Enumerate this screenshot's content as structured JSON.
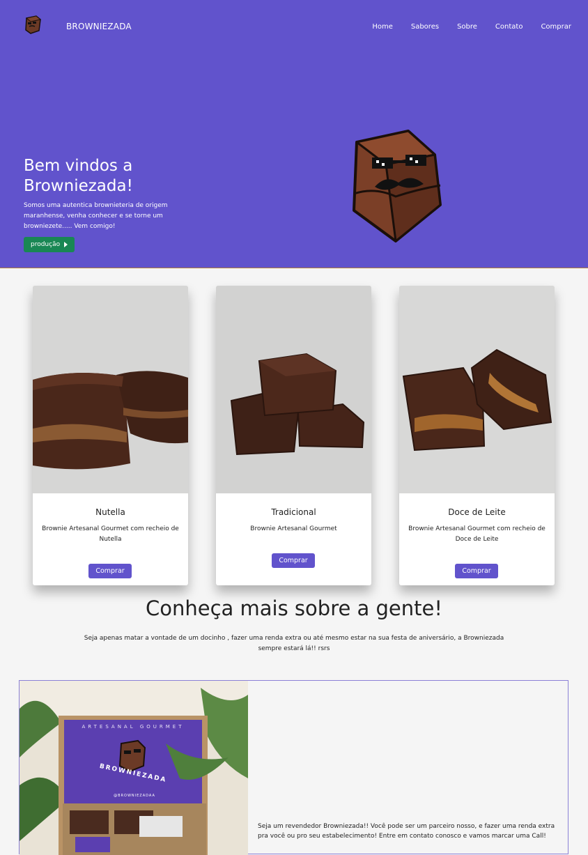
{
  "header": {
    "brand": "BROWNIEZADA",
    "nav": [
      "Home",
      "Sabores",
      "Sobre",
      "Contato",
      "Comprar"
    ]
  },
  "hero": {
    "title": "Bem vindos a Browniezada!",
    "text": "Somos uma autentica brownieteria de origem maranhense, venha conhecer e se torne um browniezete..... Vem comigo!",
    "button": "produção"
  },
  "cards": [
    {
      "title": "Nutella",
      "desc": "Brownie Artesanal Gourmet com recheio de Nutella",
      "button": "Comprar"
    },
    {
      "title": "Tradicional",
      "desc": "Brownie Artesanal Gourmet",
      "button": "Comprar"
    },
    {
      "title": "Doce de Leite",
      "desc": "Brownie Artesanal Gourmet com recheio de Doce de Leite",
      "button": "Comprar"
    }
  ],
  "about": {
    "title": "Conheça mais sobre a gente!",
    "text": "Seja apenas matar a vontade de um docinho , fazer uma renda extra ou até mesmo estar na sua festa de aniversário, a Browniezada sempre estará lá!! rsrs"
  },
  "partner": {
    "box_top": "ARTESANAL GOURMET",
    "box_brand": "BROWNIEZADA",
    "box_handle": "@BROWNIEZADAA",
    "text": "Seja um revendedor Browniezada!! Você pode ser um parceiro nosso, e fazer uma renda extra pra você ou pro seu estabelecimento! Entre em contato conosco e vamos marcar uma Call!"
  },
  "colors": {
    "primary": "#6153cc",
    "success": "#198754",
    "background": "#f5f5f5"
  }
}
